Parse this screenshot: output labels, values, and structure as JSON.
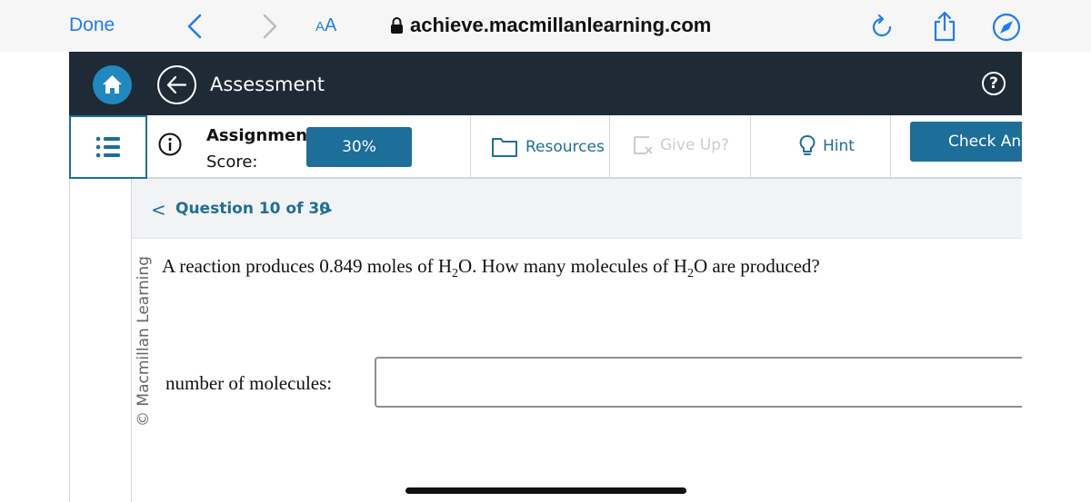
{
  "browser": {
    "done_label": "Done",
    "text_size_small": "A",
    "text_size_large": "A",
    "url": "achieve.macmillanlearning.com"
  },
  "header": {
    "title": "Assessment"
  },
  "toolbar": {
    "score_label_line1": "Assignment",
    "score_label_line2": "Score:",
    "score_value": "30%",
    "resources_label": "Resources",
    "give_up_label": "Give Up?",
    "hint_label": "Hint",
    "check_answer_label": "Check Answer"
  },
  "question_nav": {
    "prev_symbol": "<",
    "label": "Question 10 of 30",
    "next_symbol": ">"
  },
  "question": {
    "text_part1": "A reaction produces 0.849 moles of H",
    "sub1": "2",
    "text_part2": "O. How many molecules of H",
    "sub2": "2",
    "text_part3": "O are produced?"
  },
  "answer": {
    "label": "number of molecules:",
    "value": ""
  },
  "footer": {
    "copyright": "© Macmillan Learning"
  },
  "colors": {
    "accent": "#1e6e9a",
    "header_bg": "#1e2a35",
    "home_button": "#1f88be",
    "safari_blue": "#1f7cf3",
    "disabled": "#c7ced4"
  }
}
